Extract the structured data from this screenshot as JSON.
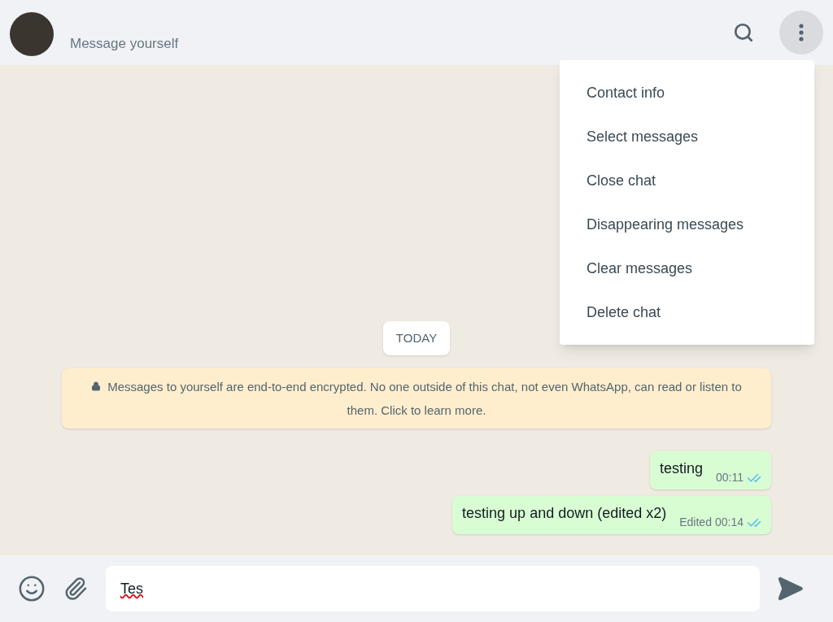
{
  "header": {
    "title": "Message yourself",
    "menu_open": true
  },
  "menu": {
    "items": [
      {
        "label": "Contact info"
      },
      {
        "label": "Select messages"
      },
      {
        "label": "Close chat"
      },
      {
        "label": "Disappearing messages"
      },
      {
        "label": "Clear messages"
      },
      {
        "label": "Delete chat"
      }
    ]
  },
  "date_chip": "TODAY",
  "encryption_notice": "Messages to yourself are end-to-end encrypted. No one outside of this chat, not even WhatsApp, can read or listen to them. Click to learn more.",
  "messages": [
    {
      "text": "testing",
      "time": "00:11",
      "read": true
    },
    {
      "text": "testing up and down (edited x2)",
      "edited_label": "Edited",
      "time": "00:14",
      "read": true
    }
  ],
  "composer": {
    "value": "Tes",
    "spellcheck_error": true
  }
}
